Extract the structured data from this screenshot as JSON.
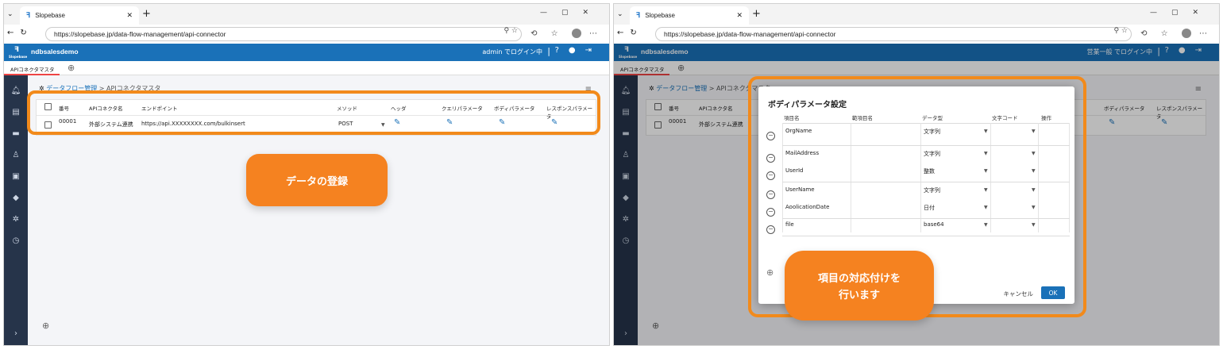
{
  "browser": {
    "tab_title": "Slopebase",
    "url": "https://slopebase.jp/data-flow-management/api-connector"
  },
  "app": {
    "logo_text": "Slopebase",
    "tenant": "ndbsalesdemo",
    "login_left": "admin でログイン中",
    "login_right": "営業一般 でログイン中",
    "tab_label": "APIコネクタマスタ"
  },
  "breadcrumb": {
    "parent": "データフロー管理",
    "separator": ">",
    "current": "APIコネクタマスタ"
  },
  "grid": {
    "headers": [
      "番号",
      "APIコネクタ名",
      "エンドポイント",
      "メソッド",
      "ヘッダ",
      "クエリパラメータ",
      "ボディパラメータ",
      "レスポンスパラメータ"
    ],
    "row": {
      "number": "00001",
      "name": "外部システム連携",
      "endpoint": "https://api.XXXXXXXX.com/bulkinsert",
      "method": "POST"
    }
  },
  "modal": {
    "title": "ボディパラメータ設定",
    "headers": [
      "項目名",
      "範項目名",
      "データ型",
      "文字コード",
      "操作"
    ],
    "rows": [
      {
        "name": "OrgName",
        "type": "文字列"
      },
      {
        "name": "MailAddress",
        "type": "文字列"
      },
      {
        "name": "UserId",
        "type": "整数"
      },
      {
        "name": "UserName",
        "type": "文字列"
      },
      {
        "name": "AoolicationDate",
        "type": "日付"
      },
      {
        "name": "file",
        "type": "base64"
      }
    ],
    "cancel": "キャンセル",
    "ok": "OK"
  },
  "callouts": {
    "left": "データの登録",
    "right_line1": "項目の対応付けを",
    "right_line2": "行います"
  },
  "colors": {
    "header_blue": "#1a71b8",
    "sidebar": "#26344a",
    "highlight_orange": "#f28a1b",
    "callout_orange": "#f58220"
  }
}
